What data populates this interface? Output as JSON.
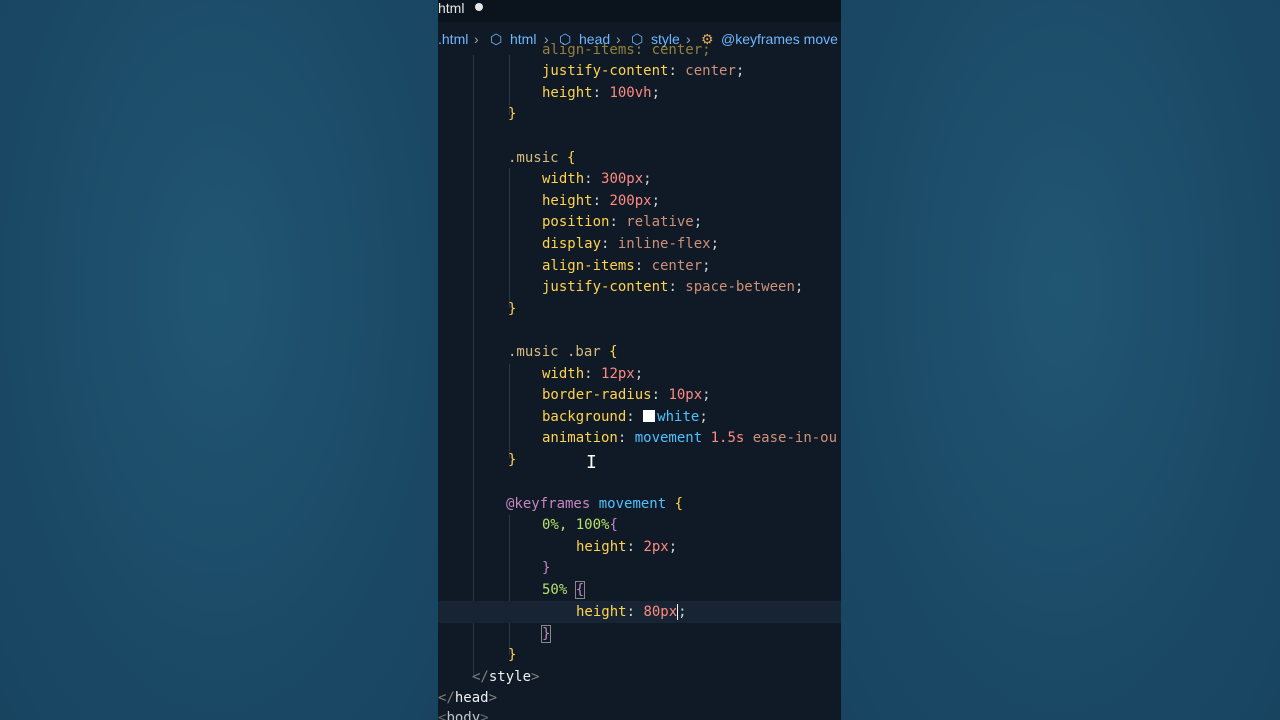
{
  "tab": {
    "label": "html"
  },
  "breadcrumb": {
    "items": [
      ".html",
      "html",
      "head",
      "style",
      "@keyframes move"
    ]
  },
  "code": {
    "l0": "align-items: center;",
    "l1_prop": "justify-content",
    "l1_val": "center",
    "l2_prop": "height",
    "l2_val": "100vh",
    "l3": "}",
    "l5_sel": ".music",
    "l6_prop": "width",
    "l6_val": "300px",
    "l7_prop": "height",
    "l7_val": "200px",
    "l8_prop": "position",
    "l8_val": "relative",
    "l9_prop": "display",
    "l9_val": "inline-flex",
    "l10_prop": "align-items",
    "l10_val": "center",
    "l11_prop": "justify-content",
    "l11_val": "space-between",
    "l14_sel": ".music .bar",
    "l15_prop": "width",
    "l15_val": "12px",
    "l16_prop": "border-radius",
    "l16_val": "10px",
    "l17_prop": "background",
    "l17_val": "white",
    "l18_prop": "animation",
    "l18_anim": "movement",
    "l18_rest": "1.5s",
    "l18_tail": "ease-in-ou",
    "l21_kw": "@keyframes",
    "l21_name": "movement",
    "l22_pct": "0%, 100%",
    "l23_prop": "height",
    "l23_val": "2px",
    "l25_pct": "50%",
    "l26_prop": "height",
    "l26_val": "80px",
    "l29_tag": "style",
    "l30_tag": "head",
    "l31_tag": "body"
  },
  "colors": {
    "background": "#1d4d6b",
    "editor_bg": "#0f1a26",
    "property": "#ffd34e",
    "value": "#ce9178",
    "number": "#ff8a80",
    "selector": "#d7ba7d",
    "animation_name": "#4fc1ff",
    "keyframe_percent": "#b5e06b"
  }
}
